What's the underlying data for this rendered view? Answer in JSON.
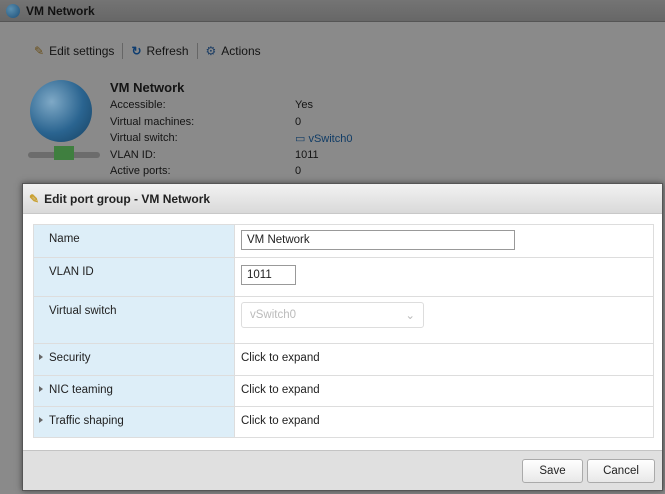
{
  "window": {
    "title": "VM Network"
  },
  "toolbar": {
    "edit": "Edit settings",
    "refresh": "Refresh",
    "actions": "Actions"
  },
  "summary": {
    "title": "VM Network",
    "rows": [
      {
        "k": "Accessible:",
        "v": "Yes"
      },
      {
        "k": "Virtual machines:",
        "v": "0"
      },
      {
        "k": "Virtual switch:",
        "v": "vSwitch0"
      },
      {
        "k": "VLAN ID:",
        "v": "1011"
      },
      {
        "k": "Active ports:",
        "v": "0"
      }
    ]
  },
  "dialog": {
    "title": "Edit port group - VM Network",
    "name_label": "Name",
    "name_value": "VM Network",
    "vlan_label": "VLAN ID",
    "vlan_value": "1011",
    "vswitch_label": "Virtual switch",
    "vswitch_value": "vSwitch0",
    "sections": [
      {
        "label": "Security",
        "value": "Click to expand"
      },
      {
        "label": "NIC teaming",
        "value": "Click to expand"
      },
      {
        "label": "Traffic shaping",
        "value": "Click to expand"
      }
    ],
    "save": "Save",
    "cancel": "Cancel"
  }
}
